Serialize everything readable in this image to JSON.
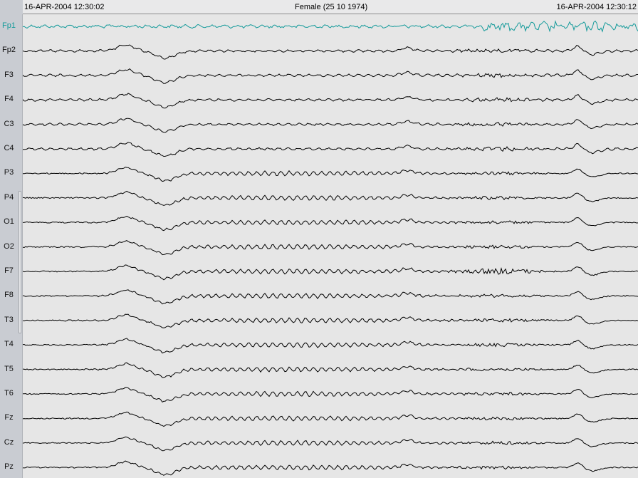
{
  "header": {
    "start_time": "16-APR-2004 12:30:02",
    "patient": "Female (25 10 1974)",
    "end_time": "16-APR-2004 12:30:12"
  },
  "channels": [
    "Fp1",
    "Fp2",
    "F3",
    "F4",
    "C3",
    "C4",
    "P3",
    "P4",
    "O1",
    "O2",
    "F7",
    "F8",
    "T3",
    "T4",
    "T5",
    "T6",
    "Fz",
    "Cz",
    "Pz"
  ],
  "selected_channel": "Fp1",
  "colors": {
    "selected_trace": "#139a9a",
    "trace": "#000000",
    "plot_background": "#e6e6e6"
  }
}
